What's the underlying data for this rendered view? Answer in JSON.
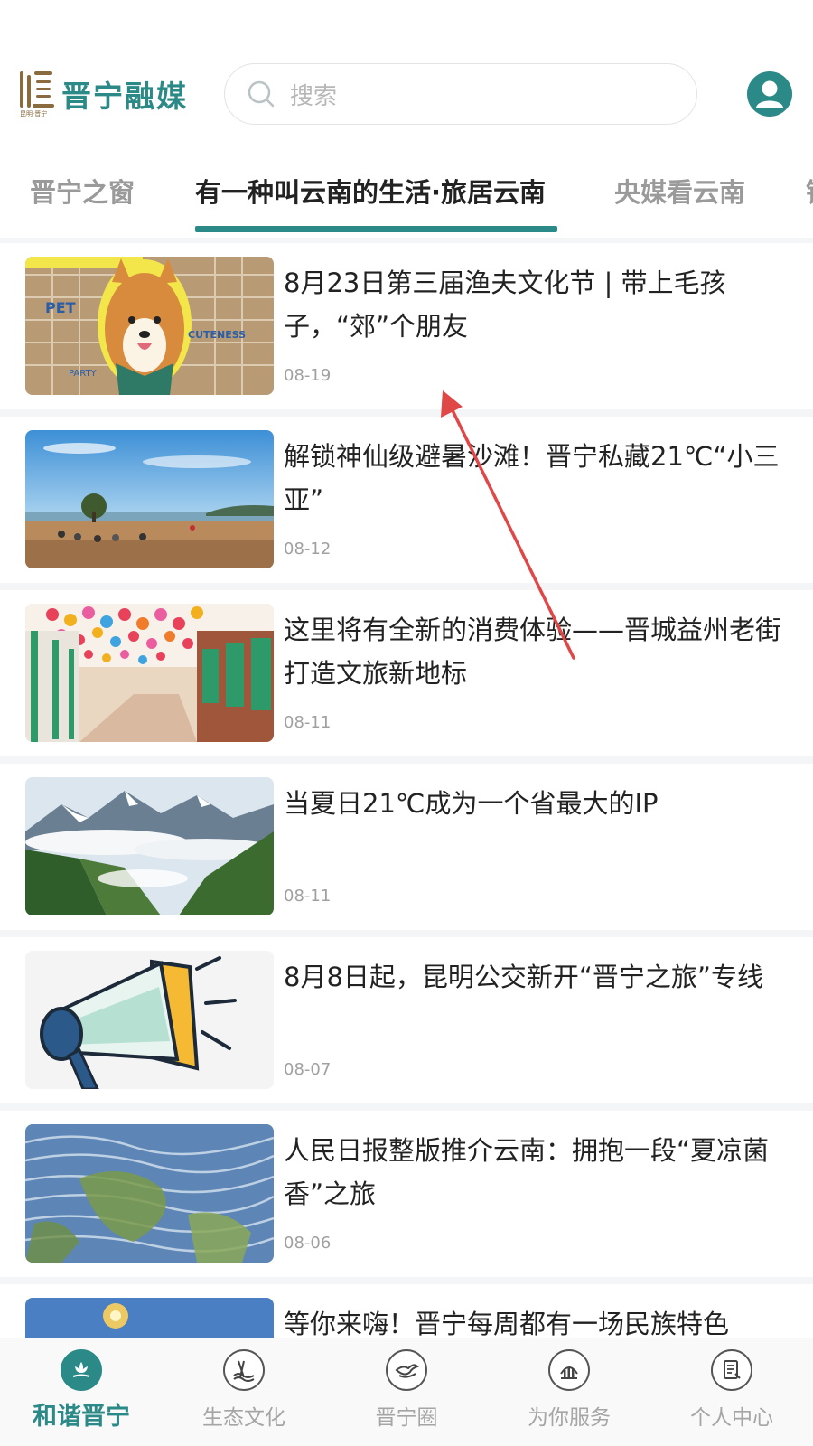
{
  "header": {
    "logo_text": "晋宁融媒",
    "logo_subtext": "昆明·晋宁",
    "search_placeholder": "搜索"
  },
  "tabs": [
    {
      "label": "晋宁之窗",
      "active": false
    },
    {
      "label": "有一种叫云南的生活·旅居云南",
      "active": true
    },
    {
      "label": "央媒看云南",
      "active": false
    },
    {
      "label": "银",
      "active": false
    }
  ],
  "news": [
    {
      "title": "8月23日第三届渔夫文化节 | 带上毛孩子，“郊”个朋友",
      "date": "08-19",
      "thumb": "corgi-pet-party"
    },
    {
      "title": "解锁神仙级避暑沙滩！晋宁私藏21℃“小三亚”",
      "date": "08-12",
      "thumb": "beach-lake"
    },
    {
      "title": "这里将有全新的消费体验——晋城益州老街打造文旅新地标",
      "date": "08-11",
      "thumb": "umbrella-street"
    },
    {
      "title": "当夏日21℃成为一个省最大的IP",
      "date": "08-11",
      "thumb": "misty-mountains"
    },
    {
      "title": "8月8日起，昆明公交新开“晋宁之旅”专线",
      "date": "08-07",
      "thumb": "megaphone"
    },
    {
      "title": "人民日报整版推介云南：拥抱一段“夏凉菌香”之旅",
      "date": "08-06",
      "thumb": "rice-terraces"
    },
    {
      "title": "等你来嗨！晋宁每周都有一场民族特色",
      "date": "",
      "thumb": "festival-lights"
    }
  ],
  "bottom_nav": [
    {
      "label": "和谐晋宁",
      "icon": "lotus-icon",
      "active": true
    },
    {
      "label": "生态文化",
      "icon": "waves-icon",
      "active": false
    },
    {
      "label": "晋宁圈",
      "icon": "bird-icon",
      "active": false
    },
    {
      "label": "为你服务",
      "icon": "chart-icon",
      "active": false
    },
    {
      "label": "个人中心",
      "icon": "document-icon",
      "active": false
    }
  ],
  "colors": {
    "accent": "#2b8a87",
    "logo_brown": "#8a6a3f",
    "annotation_arrow": "#e04848"
  }
}
